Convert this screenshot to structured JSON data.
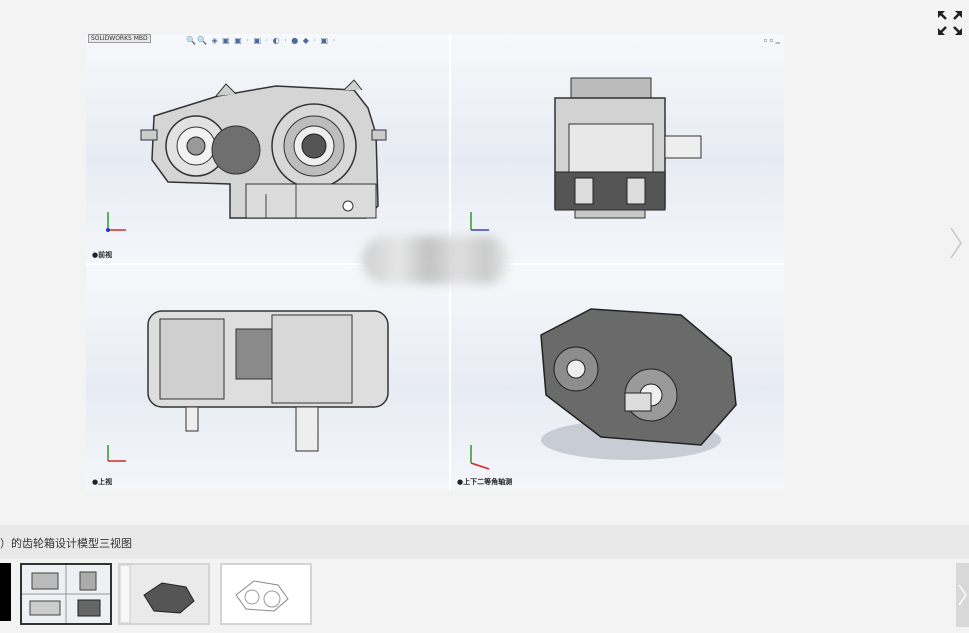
{
  "viewer": {
    "expand_icon": "expand-arrows-icon",
    "next_icon": "chevron-right-icon"
  },
  "cad": {
    "badge": "SOLIDWORKS MBD",
    "toolbar_glyphs": "🔍🔍 ◈ ▣ ▣ · ▣ · ◐ · ● ◆ · ▣ ·",
    "window_controls": "▫ ▫ ▁",
    "panes": [
      {
        "label": "●前视"
      },
      {
        "label": ""
      },
      {
        "label": "●上视"
      },
      {
        "label": "●上下二等角轴测"
      }
    ]
  },
  "caption": "）的齿轮箱设计模型三视图",
  "thumbnails": {
    "items": [
      "four-view",
      "shaded-3d",
      "wireframe-3d"
    ],
    "active_index": 0
  }
}
